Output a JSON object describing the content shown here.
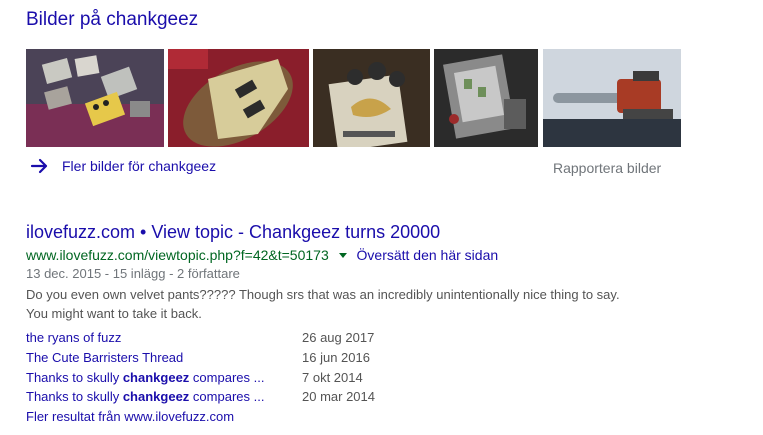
{
  "images_section": {
    "heading": "Bilder på chankgeez",
    "thumbnails": [
      {
        "name": "pedalboard-on-rug",
        "colors": [
          "#5a4f63",
          "#8c3a5a",
          "#c9c9c2",
          "#e6c84a"
        ]
      },
      {
        "name": "guitar-on-fur",
        "colors": [
          "#9b2230",
          "#7d5a3a",
          "#d7cc9a",
          "#3b1c12"
        ]
      },
      {
        "name": "big-muff-pedal",
        "colors": [
          "#3a2e22",
          "#d8d2bf",
          "#2d2d2d",
          "#b78f3e"
        ]
      },
      {
        "name": "open-pedal-circuit",
        "colors": [
          "#2b2b2b",
          "#7a7a7a",
          "#c8c8c8",
          "#6e8f5a"
        ]
      },
      {
        "name": "chainsaw-on-shelf",
        "colors": [
          "#cfd6de",
          "#8c969f",
          "#a83b25",
          "#2d3540"
        ]
      }
    ],
    "more_label": "Fler bilder för chankgeez",
    "report_label": "Rapportera bilder"
  },
  "result": {
    "title": "ilovefuzz.com • View topic - Chankgeez turns 20000",
    "url": "www.ilovefuzz.com/viewtopic.php?f=42&t=50173",
    "translate_label": "Översätt den här sidan",
    "meta": "13 dec. 2015 - 15 inlägg - 2 författare",
    "snippet_line1": "Do you even own velvet pants????? Though srs that was an incredibly unintentionally nice thing to say.",
    "snippet_line2": "You might want to take it back.",
    "sublinks": [
      {
        "pre": "the ryans of fuzz",
        "bold": "",
        "post": "",
        "date": "26 aug 2017"
      },
      {
        "pre": "The Cute Barristers Thread",
        "bold": "",
        "post": "",
        "date": "16 jun 2016"
      },
      {
        "pre": "Thanks to skully ",
        "bold": "chankgeez",
        "post": " compares ...",
        "date": "7 okt 2014"
      },
      {
        "pre": "Thanks to skully ",
        "bold": "chankgeez",
        "post": " compares ...",
        "date": "20 mar 2014"
      }
    ],
    "more_results": "Fler resultat från www.ilovefuzz.com"
  }
}
